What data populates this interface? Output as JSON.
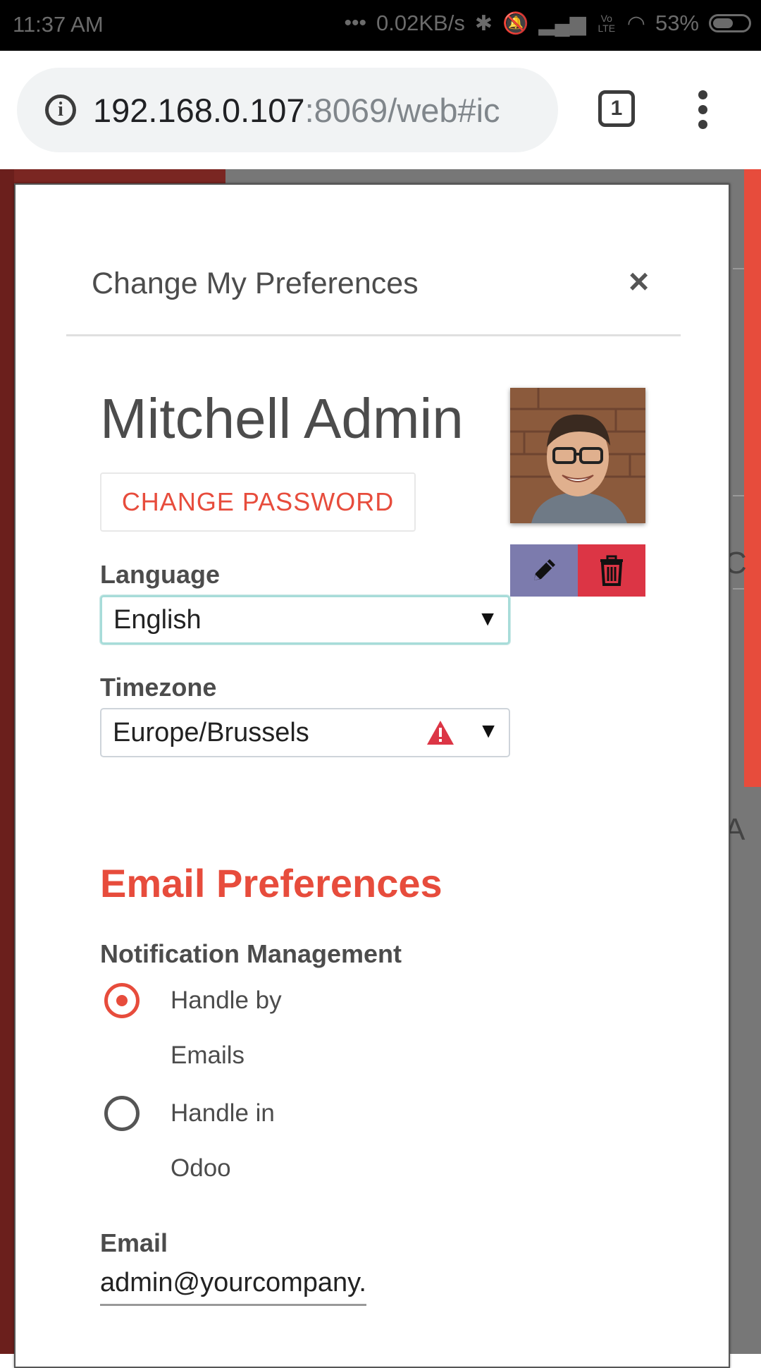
{
  "status_bar": {
    "time": "11:37 AM",
    "net_speed": "0.02KB/s",
    "volte": "Vo LTE",
    "battery": "53%"
  },
  "browser": {
    "url_host": "192.168.0.107",
    "url_rest": ":8069/web#ic",
    "tab_count": "1"
  },
  "modal": {
    "title": "Change My Preferences",
    "close": "×",
    "user_name": "Mitchell Admin",
    "change_password": "CHANGE PASSWORD",
    "language_label": "Language",
    "language_value": "English",
    "timezone_label": "Timezone",
    "timezone_value": "Europe/Brussels",
    "email_prefs_heading": "Email Preferences",
    "notification_label": "Notification Management",
    "notification_options": [
      {
        "line1": "Handle by",
        "line2": "Emails",
        "selected": true
      },
      {
        "line1": "Handle in",
        "line2": "Odoo",
        "selected": false
      }
    ],
    "email_label": "Email",
    "email_value": "admin@yourcompany."
  },
  "background_fragments": [
    "C",
    "A"
  ],
  "colors": {
    "accent": "#e74c3c",
    "edit_button": "#7c7bad",
    "delete_button": "#dc3545",
    "backdrop_sidebar": "#7a2622"
  }
}
